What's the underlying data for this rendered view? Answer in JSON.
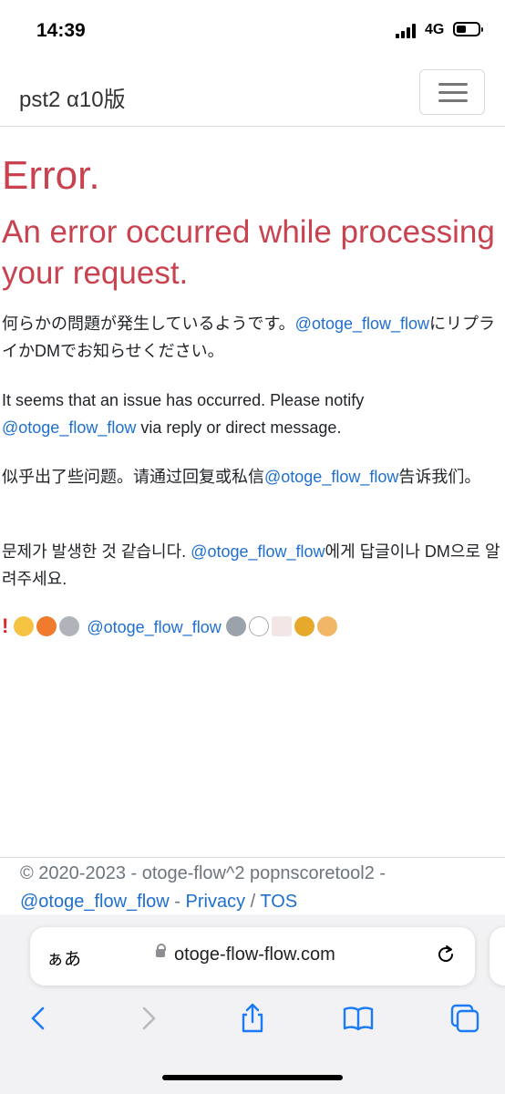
{
  "status_bar": {
    "time": "14:39",
    "network": "4G"
  },
  "navbar": {
    "brand": "pst2 α10版"
  },
  "error": {
    "title": "Error.",
    "subtitle": "An error occurred while processing your request."
  },
  "messages": {
    "ja": {
      "before": "何らかの問題が発生しているようです。",
      "handle": "@otoge_flow_flow",
      "after": "にリプライかDMでお知らせください。"
    },
    "en": {
      "before": "It seems that an issue has occurred. Please notify ",
      "handle": "@otoge_flow_flow",
      "after": " via reply or direct message."
    },
    "zh": {
      "before": "似乎出了些问题。请通过回复或私信",
      "handle": "@otoge_flow_flow",
      "after": "告诉我们。"
    },
    "ko": {
      "before": "문제가 발생한 것 같습니다. ",
      "handle": "@otoge_flow_flow",
      "after": "에게 답글이나 DM으로 알려주세요."
    },
    "emoji": {
      "handle": "@otoge_flow_flow"
    }
  },
  "footer": {
    "copyright": "© 2020-2023 - otoge-flow^2 popnscoretool2 -",
    "handle": "@otoge_flow_flow",
    "sep1": " - ",
    "privacy": "Privacy",
    "sep2": " / ",
    "tos": "TOS"
  },
  "browser": {
    "text_size_label": "ぁあ",
    "domain": "otoge-flow-flow.com"
  },
  "colors": {
    "error": "#c9424f",
    "link": "#1e6fd0",
    "ios_blue": "#1a7af8"
  }
}
